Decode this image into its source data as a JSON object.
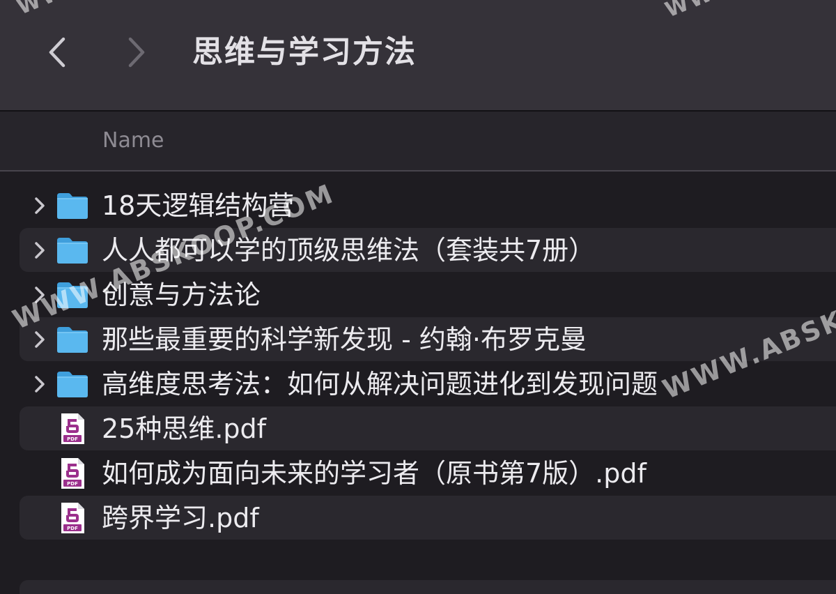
{
  "header": {
    "title": "思维与学习方法",
    "back_icon": "chevron-left-icon",
    "forward_icon": "chevron-right-icon"
  },
  "columns": {
    "name": "Name"
  },
  "items": [
    {
      "label": "18天逻辑结构营",
      "kind": "folder",
      "expandable": true
    },
    {
      "label": "人人都可以学的顶级思维法（套装共7册）",
      "kind": "folder",
      "expandable": true
    },
    {
      "label": "创意与方法论",
      "kind": "folder",
      "expandable": true
    },
    {
      "label": "那些最重要的科学新发现 - 约翰·布罗克曼",
      "kind": "folder",
      "expandable": true
    },
    {
      "label": "高维度思考法：如何从解决问题进化到发现问题",
      "kind": "folder",
      "expandable": true
    },
    {
      "label": "25种思维.pdf",
      "kind": "pdf",
      "expandable": false
    },
    {
      "label": "如何成为面向未来的学习者（原书第7版）.pdf",
      "kind": "pdf",
      "expandable": false
    },
    {
      "label": "跨界学习.pdf",
      "kind": "pdf",
      "expandable": false
    }
  ],
  "watermark": {
    "text_main": "WWW.ABSKOOP.COM",
    "text_right": "WWW.ABSKO",
    "text_top_left": "WW",
    "text_top_right": "WW"
  },
  "colors": {
    "folder_blue": "#5ab8ef",
    "pdf_purple": "#9b2f8c",
    "toolbar_bg": "#353239",
    "list_bg": "#1e1c21",
    "alt_row_bg": "#2a282e"
  }
}
